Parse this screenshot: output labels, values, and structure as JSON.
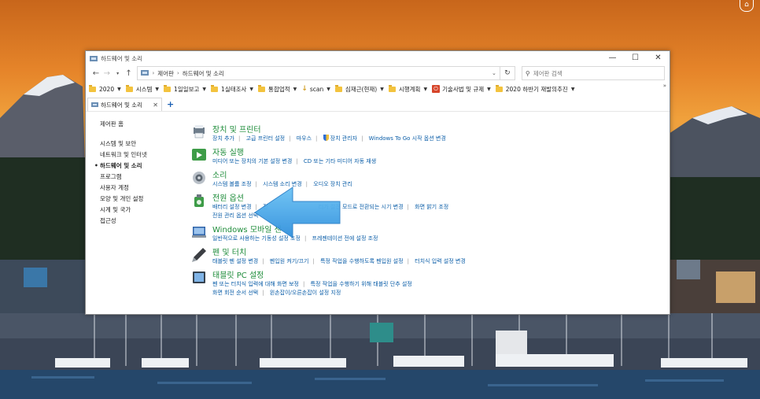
{
  "window": {
    "title": "하드웨어 및 소리",
    "controls": [
      "—",
      "☐",
      "✕"
    ]
  },
  "address": {
    "breadcrumbs": [
      "제어판",
      "하드웨어 및 소리"
    ],
    "search_placeholder": "제어판 검색"
  },
  "bookmarks": [
    {
      "label": "2020",
      "type": "folder"
    },
    {
      "label": "시스템",
      "type": "folder"
    },
    {
      "label": "1일일보고",
      "type": "folder"
    },
    {
      "label": "1실태조사",
      "type": "folder"
    },
    {
      "label": "통합업적",
      "type": "folder"
    },
    {
      "label": "scan",
      "type": "download"
    },
    {
      "label": "심재근(현재)",
      "type": "folder"
    },
    {
      "label": "시행계획",
      "type": "folder"
    },
    {
      "label": "기술사법 및 규제",
      "type": "red"
    },
    {
      "label": "2020 하반기 재발의추진",
      "type": "folder"
    }
  ],
  "bookmarks_more": "»",
  "tabs": [
    {
      "label": "하드웨어 및 소리",
      "active": true
    }
  ],
  "add_tab_label": "+",
  "sidebar": {
    "home": "제어판 홈",
    "items": [
      {
        "label": "시스템 및 보안",
        "current": false
      },
      {
        "label": "네트워크 및 인터넷",
        "current": false
      },
      {
        "label": "하드웨어 및 소리",
        "current": true
      },
      {
        "label": "프로그램",
        "current": false
      },
      {
        "label": "사용자 계정",
        "current": false
      },
      {
        "label": "모양 및 개인 설정",
        "current": false
      },
      {
        "label": "시계 및 국가",
        "current": false
      },
      {
        "label": "접근성",
        "current": false
      }
    ]
  },
  "categories": [
    {
      "title": "장치 및 프린터",
      "icon": "printer-icon",
      "links": [
        "장치 추가",
        "고급 프린터 설정",
        "마우스",
        "장치 관리자",
        "Windows To Go 시작 옵션 변경"
      ],
      "links2": []
    },
    {
      "title": "자동 실행",
      "icon": "autoplay-icon",
      "links": [
        "미디어 또는 장치의 기본 설정 변경",
        "CD 또는 기타 미디어 자동 재생"
      ],
      "links2": []
    },
    {
      "title": "소리",
      "icon": "speaker-icon",
      "links": [
        "시스템 볼륨 조정",
        "시스템 소리 변경",
        "오디오 장치 관리"
      ],
      "links2": []
    },
    {
      "title": "전원 옵션",
      "icon": "power-options-icon",
      "links": [
        "배터리 설정 변경",
        "전",
        "터가 절전 모드로 전환되는 시기 변경",
        "화면 밝기 조정"
      ],
      "links2": [
        "전원 관리 옵션 선택"
      ]
    },
    {
      "title": "Windows 모바일 센",
      "icon": "mobility-center-icon",
      "links": [
        "일반적으로 사용하는 기동성 설정 조정",
        "프레젠테이션 전에 설정 조정"
      ],
      "links2": []
    },
    {
      "title": "펜 및 터치",
      "icon": "pen-icon",
      "links": [
        "태블릿 펜 설정 변경",
        "펜입원 켜기/끄기",
        "특정 작업을 수행하도록 펜입원 설정",
        "터치식 입력 설정 변경"
      ],
      "links2": []
    },
    {
      "title": "태블릿 PC 설정",
      "icon": "tablet-icon",
      "links": [
        "펜 또는 터치식 입력에 대해 화면 보정",
        "특정 작업을 수행하기 위해 태블릿 단추 설정"
      ],
      "links2": [
        "화면 회전 순서 선택",
        "왼손잡이/오른손잡이 설정 지정"
      ]
    }
  ],
  "colors": {
    "category_title": "#1e8c3a",
    "link": "#0b5ea8",
    "arrow": "#3da6ea"
  }
}
